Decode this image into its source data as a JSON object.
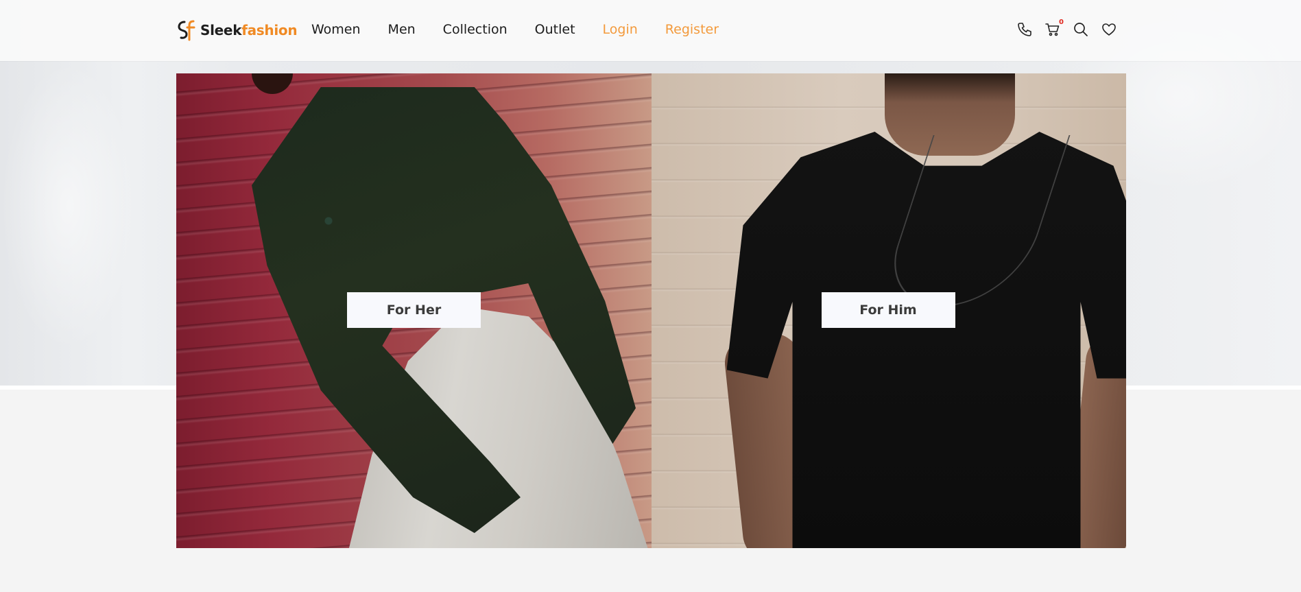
{
  "brand": {
    "name_part1": "Sleek",
    "name_part2": "fashion",
    "primary_color": "#1e1e1e",
    "accent_color": "#f08a24"
  },
  "nav": {
    "items": [
      {
        "label": "Women"
      },
      {
        "label": "Men"
      },
      {
        "label": "Collection"
      },
      {
        "label": "Outlet"
      },
      {
        "label": "Login"
      },
      {
        "label": "Register"
      }
    ],
    "accent_items": [
      "Login",
      "Register"
    ]
  },
  "header_icons": {
    "phone": "phone-icon",
    "cart": "cart-icon",
    "cart_count": "0",
    "search": "search-icon",
    "wishlist": "heart-icon"
  },
  "categories": [
    {
      "label": "For Her"
    },
    {
      "label": "For Him"
    }
  ]
}
